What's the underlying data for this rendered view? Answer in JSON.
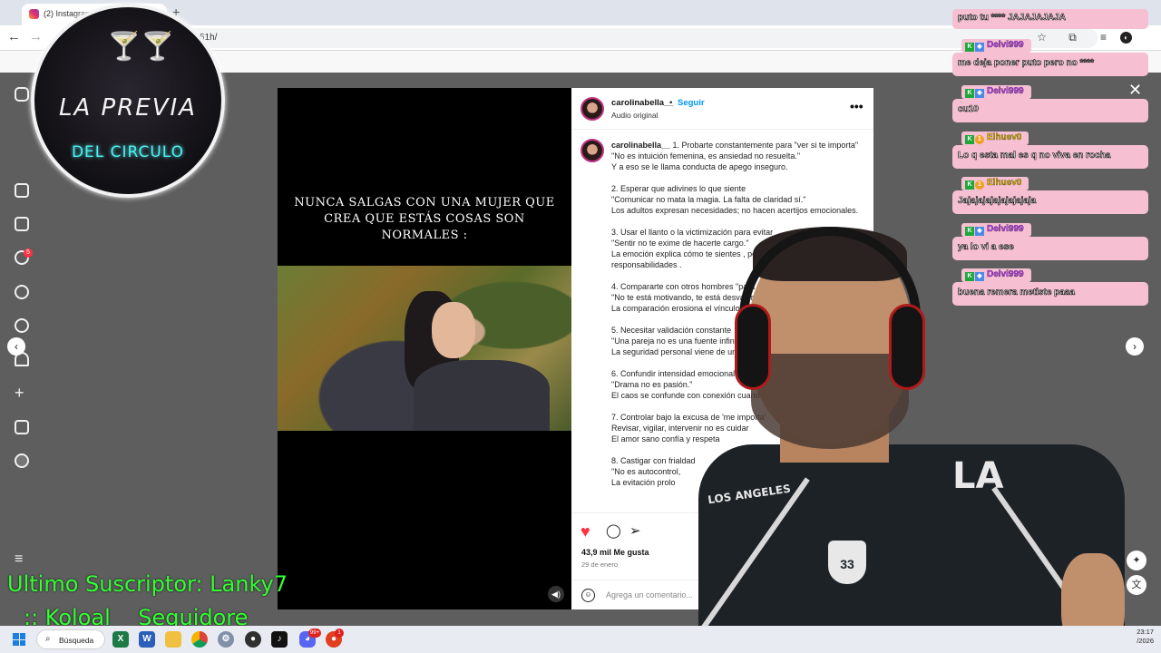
{
  "browser": {
    "tab_title": "(2) Instagram",
    "new_tab": "+",
    "url_suffix": "51h/",
    "back": "←",
    "forward": "→"
  },
  "instagram": {
    "sidebar_badge": "5",
    "media_text": "NUNCA SALGAS CON UNA MUJER QUE CREA QUE ESTÁS COSAS SON NORMALES :",
    "close": "✕",
    "prev": "‹",
    "next": "›",
    "post": {
      "username": "carolinabella__",
      "dot": "•",
      "follow": "Seguir",
      "audio": "Audio original",
      "more": "•••",
      "caption_user": "carolinabella__",
      "caption_text": " 1. Probarte constantemente para \"ver si te importa\"\n\"No es intuición femenina, es ansiedad no resuelta.\"\nY a eso se le llama conducta de apego inseguro.\n\n2. Esperar que adivines lo que siente\n\"Comunicar no mata la magia. La falta de claridad sí.\"\nLos adultos expresan necesidades; no hacen acertijos emocionales.\n\n3. Usar el llanto o la victimización para evitar\n\"Sentir no te exime de hacerte cargo.\"\nLa emoción explica cómo te sientes , pero no\nresponsabilidades .\n\n4. Compararte con otros hombres \"para mal\n\"No te está motivando, te está desvalorizando\nLa comparación erosiona el vínculo\n\n5. Necesitar validación constante\n\"Una pareja no es una fuente infinita\nLa seguridad personal viene de uno\n\n6. Confundir intensidad emocional con\n\"Drama no es pasión.\"\nEl caos se confunde con conexión cuando hay he\n\n7. Controlar bajo la excusa de 'me importa'\nRevisar, vigilar, intervenir no es cuidar\nEl amor sano confía y respeta\n\n8. Castigar con frialdad\n\"No es autocontrol,\nLa evitación prolo",
      "likes": "43,9 mil Me gusta",
      "date": "29 de enero",
      "comment_placeholder": "Agrega un comentario..."
    }
  },
  "overlay": {
    "logo_line1": "LA PREVIA",
    "logo_line2": "DEL CIRCULO",
    "last_sub": "Ultimo Suscriptor: Lanky7",
    "ticker": ":: Koloal    Seguidore",
    "shirt_text": "LOS ANGELES",
    "shirt_la": "LA",
    "shirt_num": "33"
  },
  "chat": [
    {
      "badge": "",
      "name": "",
      "msg": "puto tu **** JAJAJAJAJA"
    },
    {
      "badge": "blue",
      "name": "Delvi999",
      "msg": "me deja poner puto pero no ****"
    },
    {
      "badge": "blue",
      "name": "Delvi999",
      "msg": "cu10"
    },
    {
      "badge": "orange",
      "name": "Elhuev0",
      "msg": "Lo q esta mal es q no viva en rocha"
    },
    {
      "badge": "orange",
      "name": "Elhuev0",
      "msg": "Jajajajajajajajajaja"
    },
    {
      "badge": "blue",
      "name": "Delvi999",
      "msg": "ya lo vi a ese"
    },
    {
      "badge": "blue",
      "name": "Delvi999",
      "msg": "buena remera metiste paaa"
    }
  ],
  "taskbar": {
    "search": "Búsqueda",
    "time": "23:17",
    "date": "/2026",
    "badges": [
      "99+",
      "1"
    ]
  }
}
